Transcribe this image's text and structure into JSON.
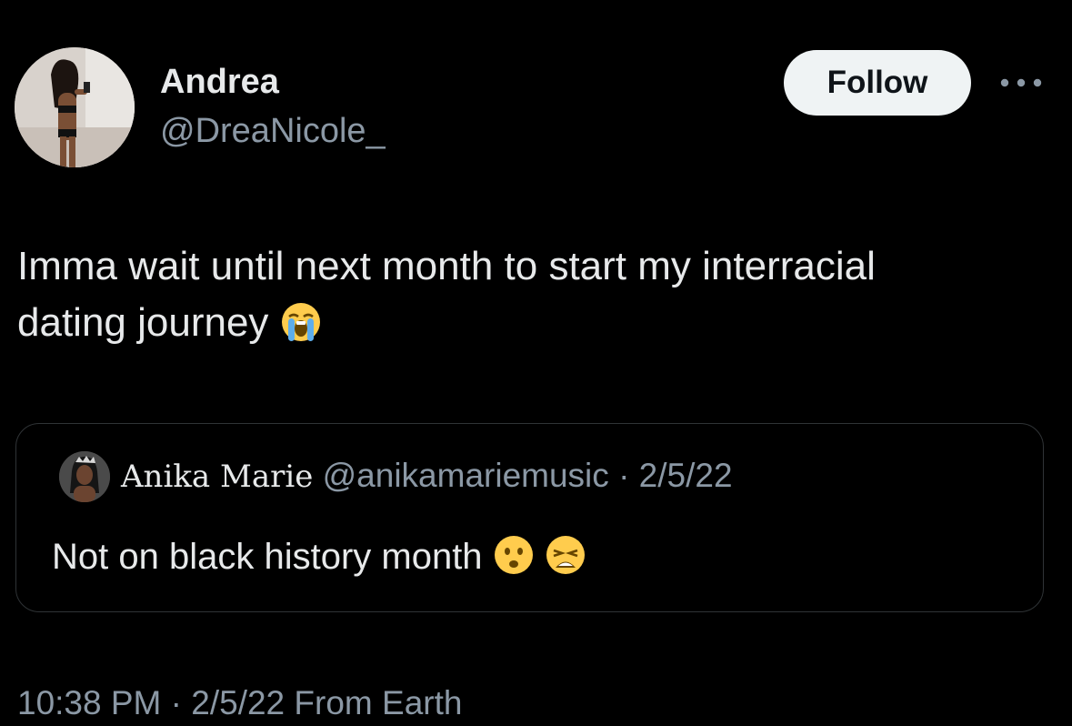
{
  "author": {
    "display_name": "Andrea",
    "handle": "@DreaNicole_",
    "avatar_icon": "profile-photo"
  },
  "actions": {
    "follow_label": "Follow",
    "more_icon": "more-dots-icon"
  },
  "tweet": {
    "text_line1": "Imma wait until next month to start my interracial",
    "text_line2": "dating journey",
    "emoji": "loudly-crying-face-emoji"
  },
  "quote": {
    "display_name": "Anika Marie",
    "handle": "@anikamariemusic",
    "separator": "·",
    "date": "2/5/22",
    "text": "Not on black history month",
    "emojis": [
      "frowning-face-emoji",
      "weary-face-emoji"
    ]
  },
  "meta": {
    "time": "10:38 PM",
    "separator": "·",
    "date": "2/5/22",
    "source": "From Earth"
  },
  "colors": {
    "background": "#000000",
    "primary_text": "#e7e9ea",
    "secondary_text": "#8b98a5",
    "border": "#2f3336",
    "follow_bg": "#eff3f4"
  }
}
